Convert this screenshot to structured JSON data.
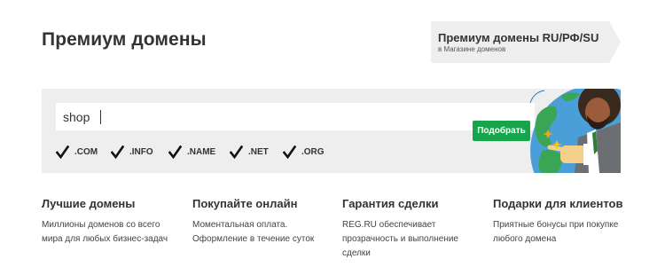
{
  "page": {
    "title": "Премиум домены"
  },
  "promo": {
    "title": "Премиум домены RU/РФ/SU",
    "subtitle": "в Магазине доменов"
  },
  "search": {
    "value": "shop",
    "button_label": "Подобрать"
  },
  "tlds": [
    {
      "label": ".COM",
      "checked": true
    },
    {
      "label": ".INFO",
      "checked": true
    },
    {
      "label": ".NAME",
      "checked": true
    },
    {
      "label": ".NET",
      "checked": true
    },
    {
      "label": ".ORG",
      "checked": true
    }
  ],
  "features": [
    {
      "title": "Лучшие домены",
      "text": "Миллионы доменов со всего мира для любых бизнес-задач"
    },
    {
      "title": "Покупайте онлайн",
      "text": "Моментальная оплата. Оформление в течение суток"
    },
    {
      "title": "Гарантия сделки",
      "text": "REG.RU обеспечивает прозрачность и выполнение сделки"
    },
    {
      "title": "Подарки для клиентов",
      "text": "Приятные бонусы при покупке любого домена"
    }
  ],
  "colors": {
    "accent": "#16a54a",
    "panel": "#eeeeee",
    "promo_bg": "#eeeeee"
  },
  "icons": {
    "checkbox": "checkmark-icon",
    "illustration": "globe-with-businessman-illustration"
  }
}
